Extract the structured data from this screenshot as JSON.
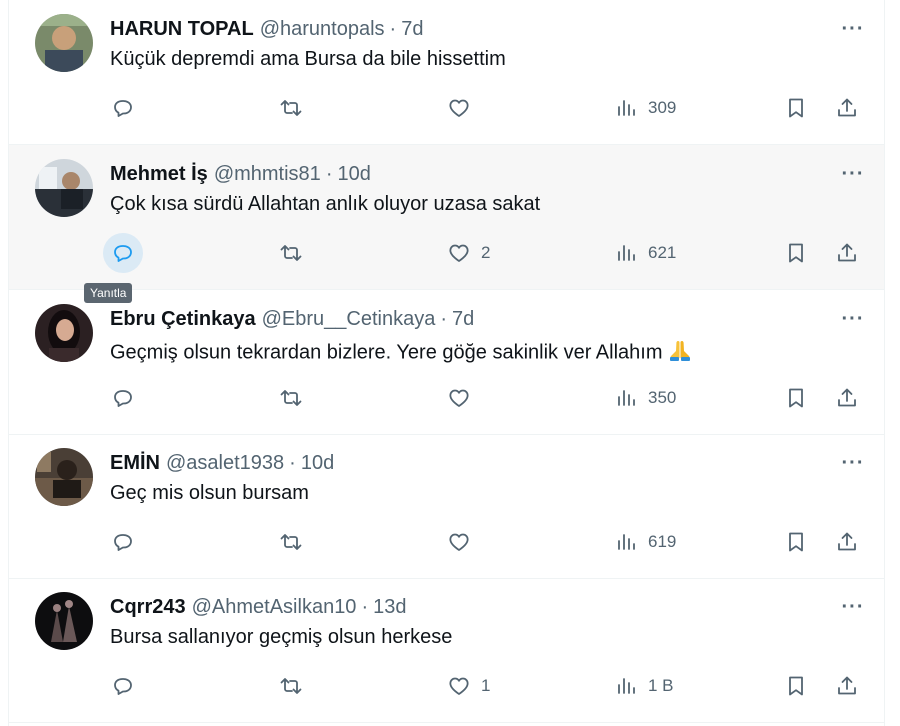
{
  "tweets": [
    {
      "name": "HARUN TOPAL",
      "handle": "@haruntopals",
      "dot": "·",
      "time": "7d",
      "text": "Küçük depremdi ama Bursa da bile hissettim",
      "likes": "",
      "views": "309",
      "more": "···"
    },
    {
      "name": "Mehmet İş",
      "handle": "@mhmtis81",
      "dot": "·",
      "time": "10d",
      "text": "Çok kısa sürdü Allahtan anlık oluyor uzasa sakat",
      "likes": "2",
      "views": "621",
      "more": "···"
    },
    {
      "name": "Ebru Çetinkaya",
      "handle": "@Ebru__Cetinkaya",
      "dot": "·",
      "time": "7d",
      "text": "Geçmiş olsun tekrardan bizlere. Yere  göğe sakinlik ver Allahım",
      "emoji": "folded-hands-icon",
      "likes": "",
      "views": "350",
      "more": "···"
    },
    {
      "name": "EMİN",
      "handle": "@asalet1938",
      "dot": "·",
      "time": "10d",
      "text": "Geç mis olsun bursam",
      "likes": "",
      "views": "619",
      "more": "···"
    },
    {
      "name": "Cqrr243",
      "handle": "@AhmetAsilkan10",
      "dot": "·",
      "time": "13d",
      "text": "Bursa sallanıyor geçmiş olsun herkese",
      "likes": "1",
      "views": "1 B",
      "more": "···"
    }
  ],
  "tooltip": "Yanıtla",
  "colors": {
    "text": "#0f1419",
    "secondary": "#536471",
    "accent": "#1d9bf0",
    "hover_bg": "#f7f7f7"
  }
}
